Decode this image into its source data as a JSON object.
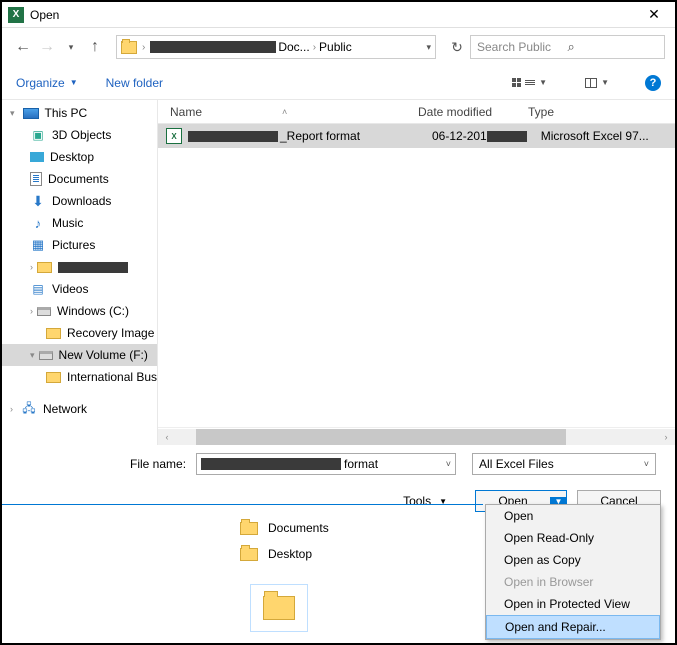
{
  "title": "Open",
  "breadcrumb": {
    "seg1": "Doc...",
    "seg2": "Public"
  },
  "search": {
    "placeholder": "Search Public"
  },
  "toolbar": {
    "organize": "Organize",
    "newfolder": "New folder"
  },
  "sidebar": {
    "thispc": "This PC",
    "items": [
      "3D Objects",
      "Desktop",
      "Documents",
      "Downloads",
      "Music",
      "Pictures",
      "Videos",
      "Windows (C:)",
      "Recovery Image",
      "New Volume (F:)",
      "International Bus"
    ],
    "network": "Network"
  },
  "columns": {
    "name": "Name",
    "date": "Date modified",
    "type": "Type"
  },
  "file": {
    "name_suffix": "_Report  format",
    "date_prefix": "06-12-201",
    "type": "Microsoft Excel 97..."
  },
  "filebar": {
    "label": "File name:",
    "value_suffix": "  format",
    "filter": "All Excel Files"
  },
  "buttons": {
    "tools": "Tools",
    "open": "Open",
    "cancel": "Cancel"
  },
  "dropdown": {
    "items": [
      "Open",
      "Open Read-Only",
      "Open as Copy",
      "Open in Browser",
      "Open in Protected View",
      "Open and Repair..."
    ]
  },
  "bg": {
    "documents": "Documents",
    "desktop": "Desktop"
  }
}
